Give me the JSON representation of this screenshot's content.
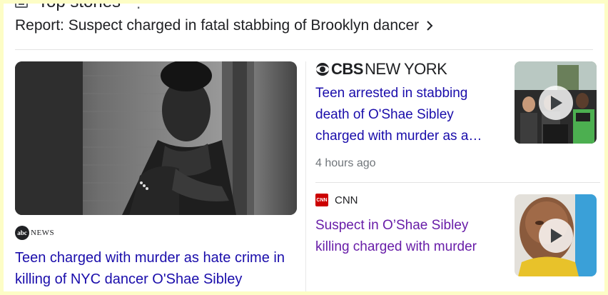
{
  "section": {
    "title": "Top stories"
  },
  "full_coverage": {
    "label": "Report: Suspect charged in fatal stabbing of Brooklyn dancer"
  },
  "stories": [
    {
      "source": "NEWS",
      "source_logo": "abc",
      "headline": "Teen charged with murder as hate crime in killing of NYC dancer O'Shae Sibley"
    },
    {
      "source_bold": "CBS",
      "source_rest": "NEW YORK",
      "headline": "Teen arrested in stabbing death of O'Shae Sibley charged with murder as a…",
      "time": "4 hours ago",
      "thumbnail": "video",
      "visited": false
    },
    {
      "source_logo": "CNN",
      "source": "CNN",
      "headline": "Suspect in O’Shae Sibley killing charged with murder",
      "thumbnail": "video",
      "visited": true
    }
  ],
  "colors": {
    "link": "#1a0dab",
    "visited": "#681da8",
    "frame": "#fdfdc6"
  }
}
